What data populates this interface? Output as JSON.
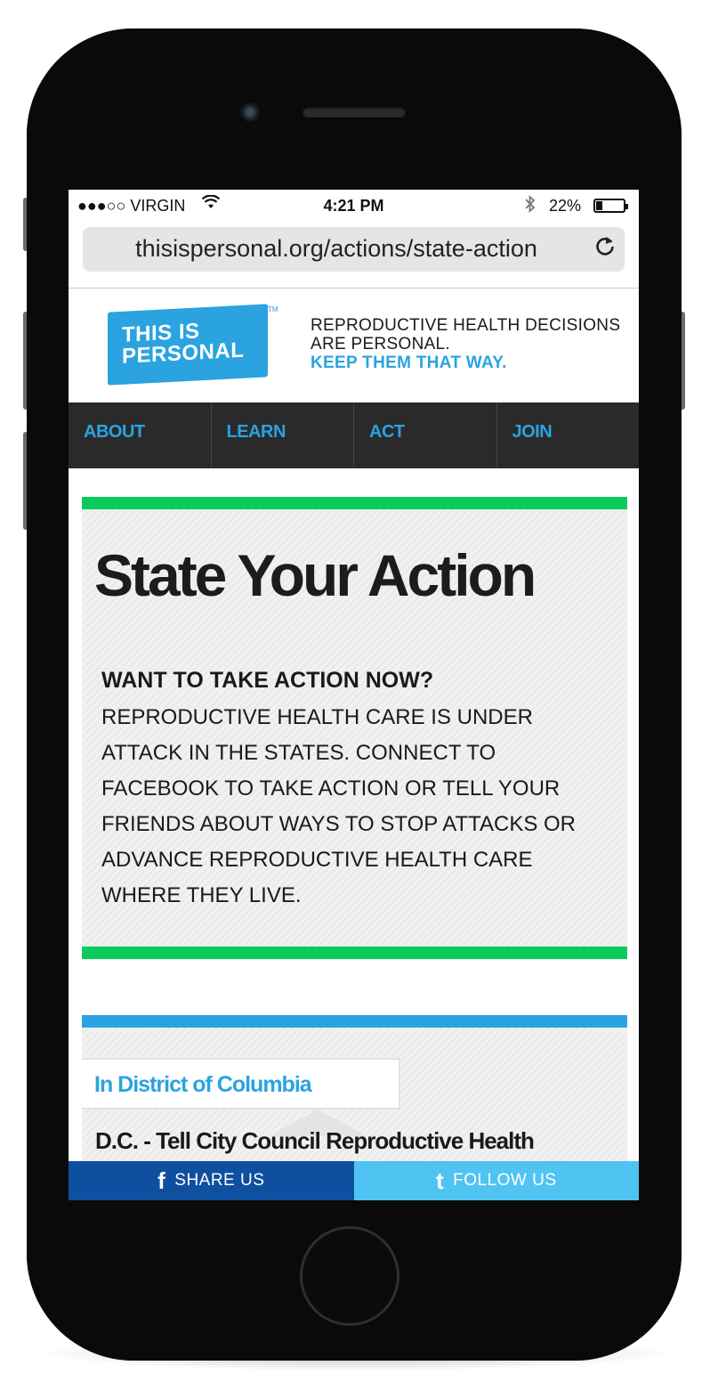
{
  "status_bar": {
    "carrier": "●●●○○ VIRGIN",
    "time": "4:21 PM",
    "battery_percent": "22%",
    "battery_level": 0.22
  },
  "browser": {
    "url": "thisispersonal.org/actions/state-action"
  },
  "logo": {
    "line1": "THIS IS",
    "line2": "PERSONAL",
    "trademark": "TM"
  },
  "tagline": {
    "line1": "REPRODUCTIVE HEALTH DECISIONS",
    "line2": "ARE PERSONAL.",
    "line3": "KEEP THEM THAT WAY."
  },
  "nav": {
    "items": [
      {
        "label": "ABOUT"
      },
      {
        "label": "LEARN"
      },
      {
        "label": "ACT"
      },
      {
        "label": "JOIN"
      }
    ]
  },
  "hero": {
    "title": "State Your Action",
    "heading": "WANT TO TAKE ACTION NOW?",
    "body": "REPRODUCTIVE HEALTH CARE IS UNDER ATTACK IN THE STATES. CONNECT TO FACEBOOK TO TAKE ACTION OR TELL YOUR FRIENDS ABOUT WAYS TO STOP ATTACKS OR ADVANCE REPRODUCTIVE HEALTH CARE WHERE THEY LIVE."
  },
  "location": {
    "label": "In District of Columbia",
    "action_title": "D.C. - Tell City Council Reproductive Health"
  },
  "bottom_bar": {
    "share_label": "SHARE US",
    "follow_label": "FOLLOW US"
  },
  "colors": {
    "brand_blue": "#2aa3e0",
    "green": "#0ccb5a",
    "nav_bg": "#2a2a2a",
    "facebook_blue": "#0f4fa0",
    "twitter_blue": "#4fc4f2"
  }
}
